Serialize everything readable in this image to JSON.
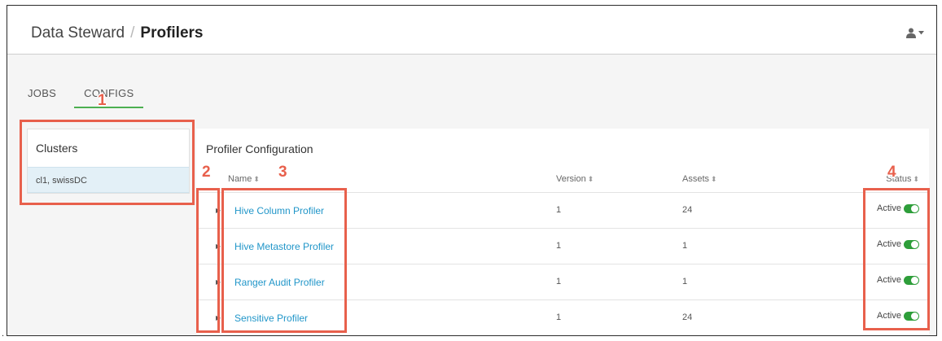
{
  "header": {
    "crumb_root": "Data Steward",
    "crumb_separator": "/",
    "crumb_current": "Profilers",
    "user_icon": "user-icon",
    "caret_icon": "caret-down-icon"
  },
  "tabs": [
    {
      "label": "JOBS",
      "active": false
    },
    {
      "label": "CONFIGS",
      "active": true
    }
  ],
  "clusters": {
    "title": "Clusters",
    "items": [
      "cl1, swissDC"
    ]
  },
  "profiler_config": {
    "title": "Profiler Configuration",
    "columns": {
      "name": "Name",
      "version": "Version",
      "assets": "Assets",
      "status": "Status"
    },
    "sort_glyph": "⬍",
    "rows": [
      {
        "name": "Hive Column Profiler",
        "version": "1",
        "assets": "24",
        "status": "Active",
        "enabled": true
      },
      {
        "name": "Hive Metastore Profiler",
        "version": "1",
        "assets": "1",
        "status": "Active",
        "enabled": true
      },
      {
        "name": "Ranger Audit Profiler",
        "version": "1",
        "assets": "1",
        "status": "Active",
        "enabled": true
      },
      {
        "name": "Sensitive Profiler",
        "version": "1",
        "assets": "24",
        "status": "Active",
        "enabled": true
      }
    ]
  },
  "annotations": [
    "1",
    "2",
    "3",
    "4"
  ],
  "stray_mark": ".",
  "colors": {
    "accent_link": "#2196c9",
    "tab_underline": "#4caf50",
    "toggle_on": "#2e9e3a",
    "callout": "#e8604c",
    "cluster_selected_bg": "#e3f0f7"
  }
}
